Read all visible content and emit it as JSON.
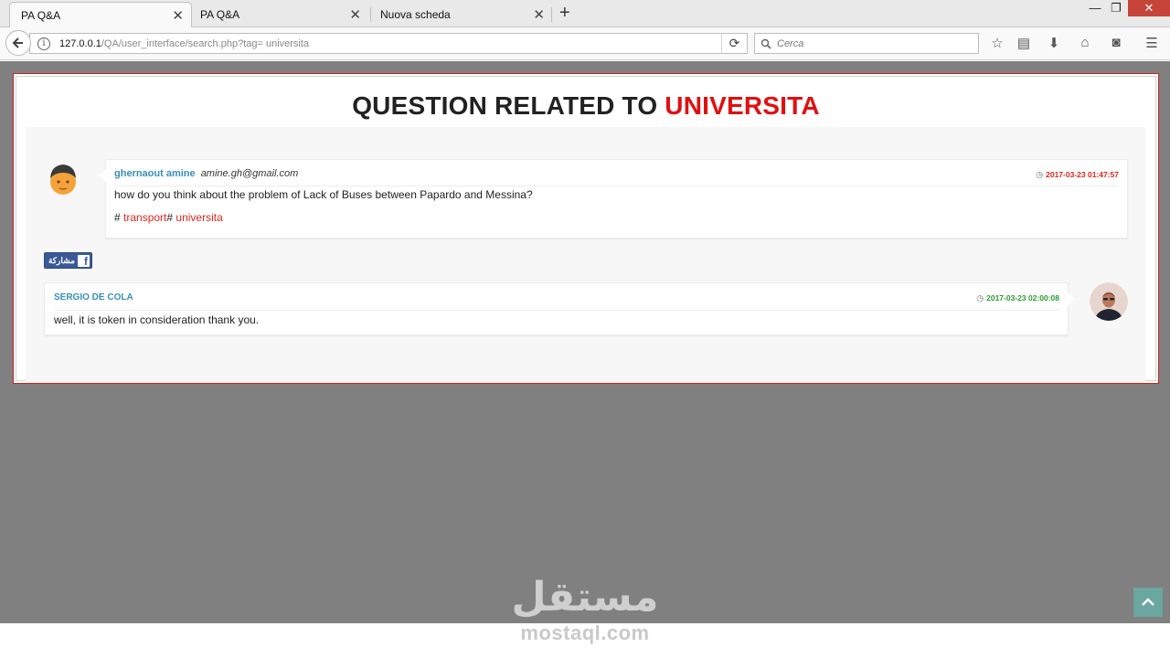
{
  "browser": {
    "tabs": [
      {
        "label": "PA Q&A",
        "active": true
      },
      {
        "label": "PA Q&A",
        "active": false
      },
      {
        "label": "Nuova scheda",
        "active": false
      }
    ],
    "new_tab": "+",
    "url_host": "127.0.0.1",
    "url_path": "/QA/user_interface/search.php?tag= universita",
    "search_placeholder": "Cerca",
    "window_controls": {
      "minimize": "—",
      "restore": "❐",
      "close": "✕"
    }
  },
  "page": {
    "heading_prefix": "QUESTION RELATED TO ",
    "heading_tag": "UNIVERSITA",
    "question": {
      "user": "ghernaout amine",
      "email": "amine.gh@gmail.com",
      "timestamp": "2017-03-23 01:47:57",
      "text": "how do you think about the problem of Lack of Buses between Papardo and Messina?",
      "tags": [
        "transport",
        "universita"
      ],
      "hash": "#"
    },
    "share_button": "مشاركة",
    "answer": {
      "user": "SERGIO DE COLA",
      "timestamp": "2017-03-23 02:00:08",
      "text": "well, it is token in consideration thank you."
    }
  },
  "watermark": {
    "arabic": "مستقل",
    "latin": "mostaql.com"
  },
  "colors": {
    "accent_red": "#e01010",
    "user_blue": "#3a8fb7",
    "answer_green": "#2e9a2e",
    "facebook": "#3b5998",
    "background_gray": "#808080"
  }
}
